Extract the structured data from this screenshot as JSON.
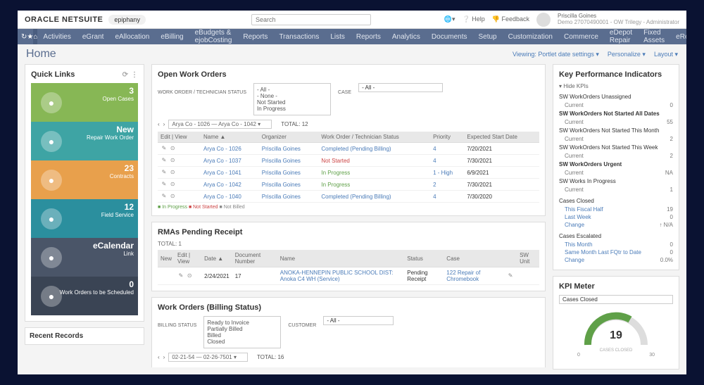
{
  "brand": "ORACLE NETSUITE",
  "brand_pill": "epiphany",
  "search_placeholder": "Search",
  "top_links": {
    "help": "Help",
    "feedback": "Feedback"
  },
  "user": {
    "name": "Priscilla Goines",
    "sub": "Demo 27070490001 - OW Trilegy - Administrator"
  },
  "nav": [
    "Activities",
    "eGrant",
    "eAllocation",
    "eBilling",
    "eBudgets & ejobCosting",
    "Reports",
    "Transactions",
    "Lists",
    "Reports",
    "Analytics",
    "Documents",
    "Setup",
    "Customization",
    "Commerce",
    "eDepot Repair",
    "Fixed Assets",
    "eReporting"
  ],
  "page_title": "Home",
  "page_bar": {
    "viewing": "Viewing: Portlet date settings ▾",
    "personalize": "Personalize ▾",
    "layout": "Layout ▾"
  },
  "quick_links_title": "Quick Links",
  "tiles": [
    {
      "n": "3",
      "label": "Open Cases",
      "cls": "t-green"
    },
    {
      "n": "New",
      "label": "Repair Work Order",
      "cls": "t-teal"
    },
    {
      "n": "23",
      "label": "Contracts",
      "cls": "t-orange"
    },
    {
      "n": "12",
      "label": "Field Service",
      "cls": "t-teal2"
    },
    {
      "n": "eCalendar",
      "label": "Link",
      "cls": "t-dark"
    },
    {
      "n": "0",
      "label": "Work Orders to be Scheduled",
      "cls": "t-darker"
    }
  ],
  "recent_records": "Recent Records",
  "owo": {
    "title": "Open Work Orders",
    "filter_label": "WORK ORDER / TECHNICIAN STATUS",
    "filter_opts": [
      "- All -",
      "- None -",
      "Not Started",
      "In Progress"
    ],
    "case_label": "CASE",
    "case_val": "- All -",
    "pager": "Arya Co - 1026 — Arya Co - 1042 ▾",
    "total": "TOTAL: 12",
    "headers": [
      "Edit | View",
      "Name ▲",
      "Organizer",
      "Work Order / Technician Status",
      "Priority",
      "Expected Start Date"
    ],
    "rows": [
      {
        "name": "Arya Co - 1026",
        "org": "Priscilla Goines",
        "status": "Completed (Pending Billing)",
        "stc": "lnk-blue",
        "pri": "4",
        "date": "7/20/2021"
      },
      {
        "name": "Arya Co - 1037",
        "org": "Priscilla Goines",
        "status": "Not Started",
        "stc": "lnk-red",
        "pri": "4",
        "date": "7/30/2021"
      },
      {
        "name": "Arya Co - 1041",
        "org": "Priscilla Goines",
        "status": "In Progress",
        "stc": "lnk-green",
        "pri": "1 - High",
        "date": "6/9/2021"
      },
      {
        "name": "Arya Co - 1042",
        "org": "Priscilla Goines",
        "status": "In Progress",
        "stc": "lnk-green",
        "pri": "2",
        "date": "7/30/2021"
      },
      {
        "name": "Arya Co - 1040",
        "org": "Priscilla Goines",
        "status": "Completed (Pending Billing)",
        "stc": "lnk-blue",
        "pri": "4",
        "date": "7/30/2020"
      }
    ],
    "legend": {
      "g": "In Progress",
      "r": "Not Started",
      "o": "Not Billed"
    }
  },
  "rma": {
    "title": "RMAs Pending Receipt",
    "total": "TOTAL: 1",
    "headers": [
      "New",
      "Edit | View",
      "Date ▲",
      "Document Number",
      "Name",
      "Status",
      "Case",
      "",
      "SW Unit"
    ],
    "row": {
      "date": "2/24/2021",
      "doc": "17",
      "name": "ANOKA-HENNEPIN PUBLIC SCHOOL DIST: Anoka C4 WH (Service)",
      "status": "Pending Receipt",
      "case": "122 Repair of Chromebook"
    }
  },
  "wob": {
    "title": "Work Orders (Billing Status)",
    "bs_label": "BILLING STATUS",
    "bs_opts": [
      "Ready to Invoice",
      "Partially Billed",
      "Billed",
      "Closed"
    ],
    "cust_label": "CUSTOMER",
    "cust_val": "- All -",
    "pager": "02-21-54 — 02-26-7501 ▾",
    "total": "TOTAL: 16"
  },
  "kpi": {
    "title": "Key Performance Indicators",
    "toggle": "▾ Hide KPIs",
    "rows": [
      {
        "t": "SW WorkOrders Unassigned",
        "sub": "Current",
        "v": "0"
      },
      {
        "t": "SW WorkOrders Not Started All Dates",
        "sub": "Current",
        "v": "55",
        "bold": true
      },
      {
        "t": "SW WorkOrders Not Started This Month",
        "sub": "Current",
        "v": "2"
      },
      {
        "t": "SW WorkOrders Not Started This Week",
        "sub": "Current",
        "v": "2"
      },
      {
        "t": "SW WorkOrders Urgent",
        "sub": "Current",
        "v": "NA",
        "bold": true
      },
      {
        "t": "SW Works In Progress",
        "sub": "Current",
        "v": "1"
      }
    ],
    "closed": {
      "t": "Cases Closed",
      "rows": [
        {
          "l": "This Fiscal Half",
          "v": "19"
        },
        {
          "l": "Last Week",
          "v": "0"
        },
        {
          "l": "Change",
          "v": "↑ N/A"
        }
      ]
    },
    "esc": {
      "t": "Cases Escalated",
      "rows": [
        {
          "l": "This Month",
          "v": "0"
        },
        {
          "l": "Same Month Last FQtr to Date",
          "v": "0"
        },
        {
          "l": "Change",
          "v": "0.0%"
        }
      ]
    }
  },
  "meter": {
    "title": "KPI Meter",
    "sel": "Cases Closed",
    "value": "19",
    "sub": "CASES CLOSED",
    "min": "0",
    "max": "30"
  }
}
